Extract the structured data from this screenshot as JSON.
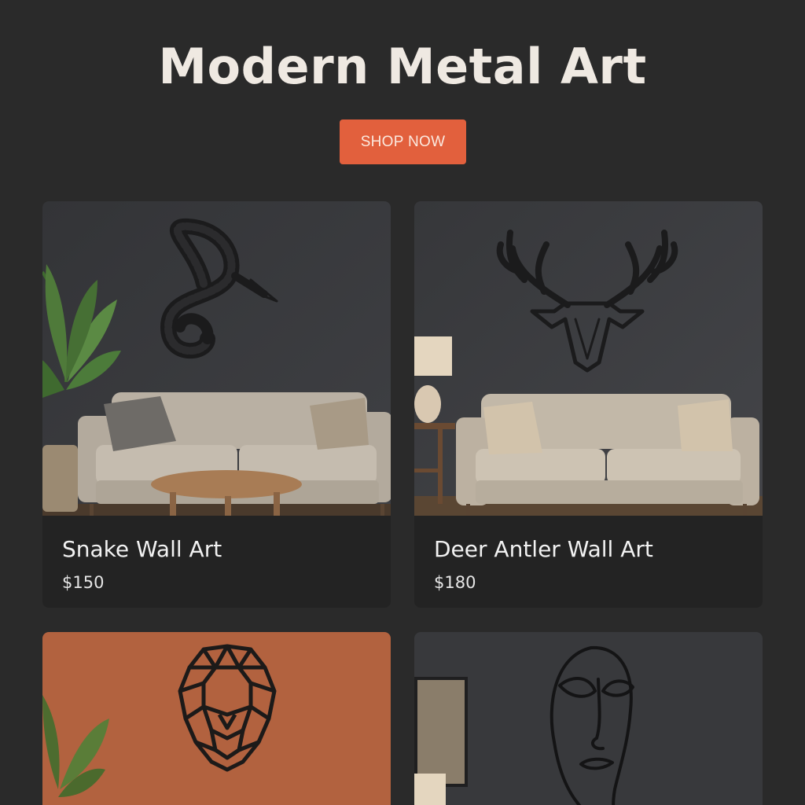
{
  "header": {
    "title": "Modern Metal Art",
    "cta_label": "SHOP NOW"
  },
  "colors": {
    "background": "#2a2a2a",
    "accent": "#e2603d",
    "card": "#232323",
    "wall_dark": "#3c3d40",
    "wall_terracotta": "#b2623f"
  },
  "products": [
    {
      "name": "Snake Wall Art",
      "price": "$150",
      "art_icon": "snake-icon"
    },
    {
      "name": "Deer Antler Wall Art",
      "price": "$180",
      "art_icon": "deer-antler-icon"
    },
    {
      "name": "",
      "price": "",
      "art_icon": "lion-head-icon"
    },
    {
      "name": "",
      "price": "",
      "art_icon": "face-line-art-icon"
    }
  ]
}
